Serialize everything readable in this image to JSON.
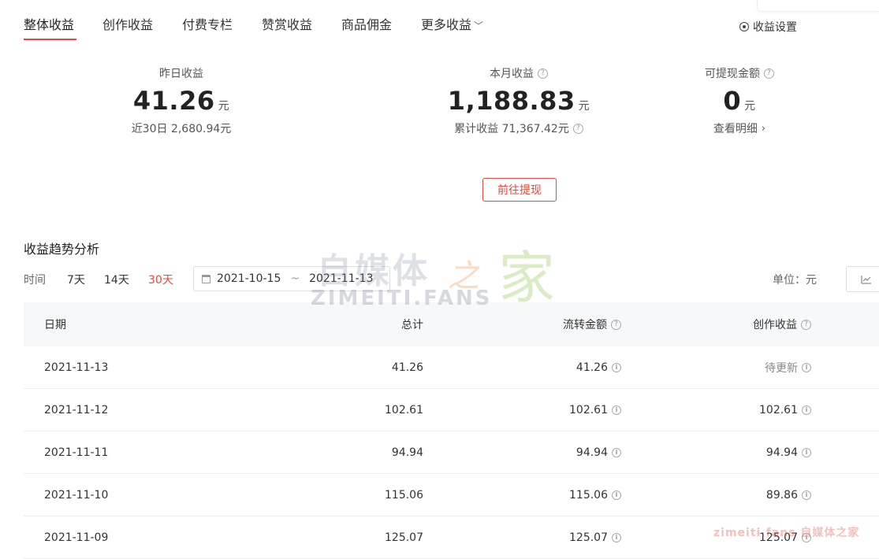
{
  "tabs": [
    {
      "label": "整体收益"
    },
    {
      "label": "创作收益"
    },
    {
      "label": "付费专栏"
    },
    {
      "label": "赞赏收益"
    },
    {
      "label": "商品佣金"
    },
    {
      "label": "更多收益"
    }
  ],
  "settings_label": "收益设置",
  "stats": {
    "yesterday": {
      "label": "昨日收益",
      "value": "41.26",
      "unit": "元",
      "sub": "近30日 2,680.94元"
    },
    "month": {
      "label": "本月收益",
      "value": "1,188.83",
      "unit": "元",
      "sub": "累计收益 71,367.42元"
    },
    "withdrawable": {
      "label": "可提现金额",
      "value": "0",
      "unit": "元",
      "sub": "查看明细"
    }
  },
  "withdraw_button": "前往提现",
  "trend": {
    "title": "收益趋势分析",
    "time_label": "时间",
    "ranges": [
      "7天",
      "14天",
      "30天"
    ],
    "active_range": "30天",
    "date_start": "2021-10-15",
    "date_sep": "~",
    "date_end": "2021-11-13",
    "unit_label": "单位：元"
  },
  "table": {
    "headers": {
      "date": "日期",
      "total": "总计",
      "flow": "流转金额",
      "create": "创作收益"
    },
    "rows": [
      {
        "date": "2021-11-13",
        "total": "41.26",
        "flow": "41.26",
        "create": "待更新"
      },
      {
        "date": "2021-11-12",
        "total": "102.61",
        "flow": "102.61",
        "create": "102.61"
      },
      {
        "date": "2021-11-11",
        "total": "94.94",
        "flow": "94.94",
        "create": "94.94"
      },
      {
        "date": "2021-11-10",
        "total": "115.06",
        "flow": "115.06",
        "create": "89.86"
      },
      {
        "date": "2021-11-09",
        "total": "125.07",
        "flow": "125.07",
        "create": "125.07"
      }
    ]
  },
  "watermark": {
    "cn": "自媒体",
    "wave": "之",
    "jia": "家",
    "en": "ZIMEITI.FANS",
    "corner": "zimeiti.fans 自媒体之家"
  },
  "colors": {
    "accent": "#e04b3f",
    "header_bg": "#f7f8fa",
    "border": "#eeeeee"
  }
}
